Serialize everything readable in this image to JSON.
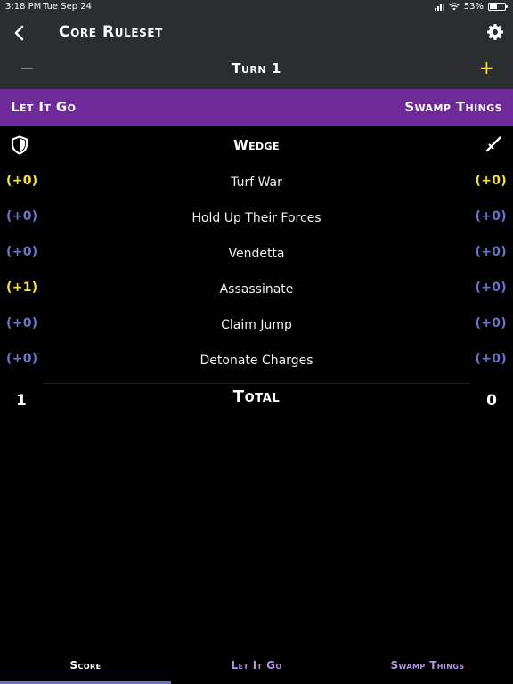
{
  "status": {
    "time": "3:18 PM",
    "date": "Tue Sep 24",
    "battery": "53%",
    "battery_level": 0.53
  },
  "nav": {
    "title": "Core Ruleset",
    "turn": "Turn 1",
    "minus": "−",
    "plus": "+"
  },
  "teams": {
    "left": "Let It Go",
    "right": "Swamp Things"
  },
  "mode": "Wedge",
  "objectives": [
    {
      "name": "Turf War",
      "left": "(+0)",
      "right": "(+0)",
      "left_style": "pos",
      "right_style": "pos"
    },
    {
      "name": "Hold Up Their Forces",
      "left": "(+0)",
      "right": "(+0)",
      "left_style": "neutral",
      "right_style": "neutral"
    },
    {
      "name": "Vendetta",
      "left": "(+0)",
      "right": "(+0)",
      "left_style": "neutral",
      "right_style": "neutral"
    },
    {
      "name": "Assassinate",
      "left": "(+1)",
      "right": "(+0)",
      "left_style": "pos",
      "right_style": "neutral"
    },
    {
      "name": "Claim Jump",
      "left": "(+0)",
      "right": "(+0)",
      "left_style": "neutral",
      "right_style": "neutral"
    },
    {
      "name": "Detonate Charges",
      "left": "(+0)",
      "right": "(+0)",
      "left_style": "neutral",
      "right_style": "neutral"
    }
  ],
  "total": {
    "label": "Total",
    "left": "1",
    "right": "0"
  },
  "tabs": {
    "score": "Score",
    "left": "Let It Go",
    "right": "Swamp Things"
  },
  "colors": {
    "nav_bg": "#2b2e31",
    "team_bar": "#6e2a99",
    "positive": "#f7e23b",
    "neutral": "#6b74c6",
    "tab_inactive": "#b496e0"
  },
  "icons": [
    "back-chevron-icon",
    "gear-icon",
    "shield-icon",
    "sword-icon",
    "wifi-icon",
    "battery-icon",
    "signal-icon"
  ]
}
